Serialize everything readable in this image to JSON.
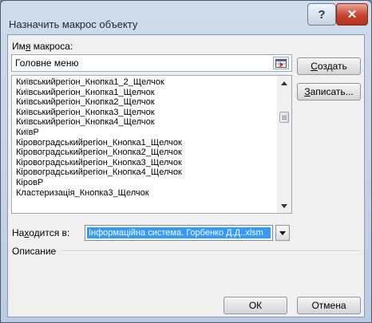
{
  "window": {
    "title": "Назначить макрос объекту"
  },
  "titlebar_buttons": {
    "help_icon": "?",
    "close_icon": "✕"
  },
  "macro_name": {
    "label_before": "Им",
    "label_mnemonic": "я",
    "label_after": " макроса:",
    "value": "Головне меню"
  },
  "macro_list": {
    "items": [
      "Київськийрегіон_Кнопка1_2_Щелчок",
      "Київськийрегіон_Кнопка1_Щелчок",
      "Київськийрегіон_Кнопка2_Щелчок",
      "Київськийрегіон_Кнопка3_Щелчок",
      "Київськийрегіон_Кнопка4_Щелчок",
      "КиївР",
      "Кіровоградськийрегіон_Кнопка1_Щелчок",
      "Кіровоградськийрегіон_Кнопка2_Щелчок",
      "Кіровоградськийрегіон_Кнопка3_Щелчок",
      "Кіровоградськийрегіон_Кнопка4_Щелчок",
      "КіровР",
      "Кластеризація_Кнопка3_Щелчок"
    ]
  },
  "buttons": {
    "create_mnemonic": "С",
    "create_rest": "оздать",
    "record_mnemonic": "З",
    "record_rest": "аписать...",
    "ok": "ОК",
    "cancel": "Отмена"
  },
  "macros_in": {
    "label_before": "На",
    "label_mnemonic": "х",
    "label_after": "одится в:",
    "value": "Інформаційна система. Горбенко Д.Д..xlsm"
  },
  "description": {
    "label": "Описание"
  },
  "colors": {
    "selection": "#3399ff",
    "close_button": "#c4432f"
  }
}
